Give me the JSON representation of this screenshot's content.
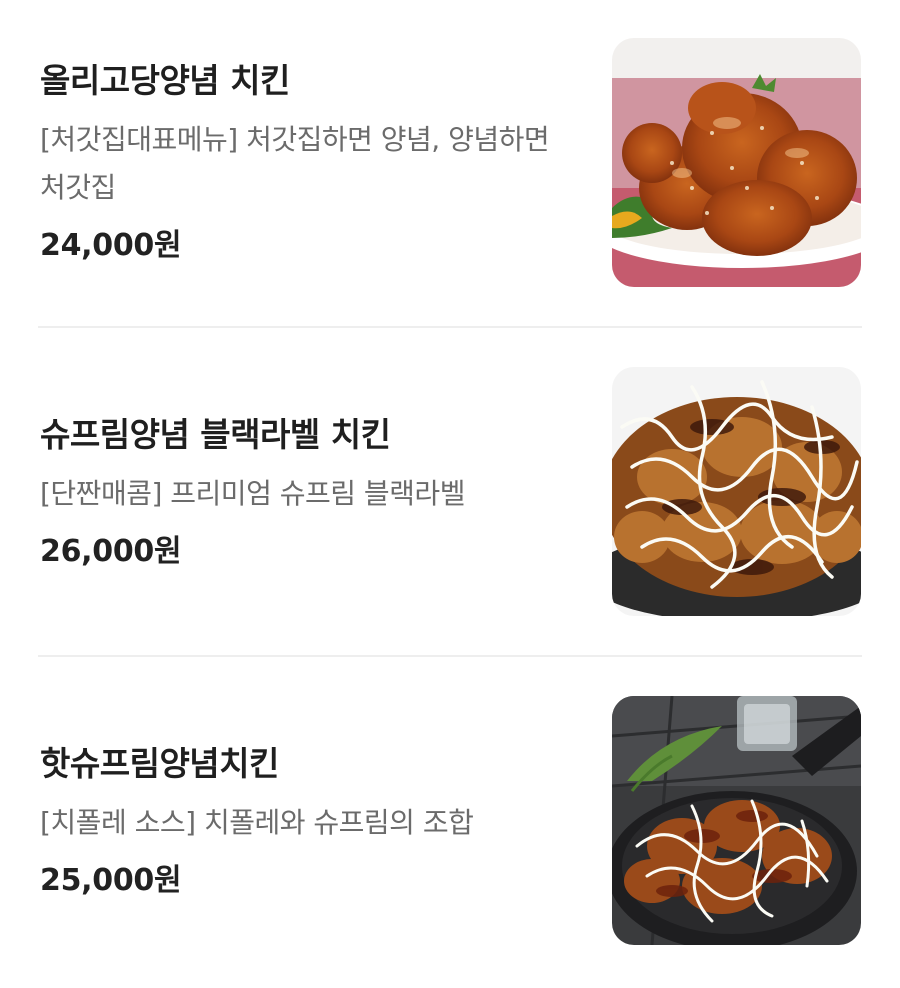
{
  "menu": {
    "items": [
      {
        "name": "올리고당양념 치킨",
        "description": "[처갓집대표메뉴] 처갓집하면 양념, 양념하면 처갓집",
        "price": "24,000원",
        "image": "yangnyeom-chicken-plate-photo"
      },
      {
        "name": "슈프림양념 블랙라벨 치킨",
        "description": "[단짠매콤] 프리미엄 슈프림 블랙라벨",
        "price": "26,000원",
        "image": "black-label-chicken-bowl-photo"
      },
      {
        "name": "핫슈프림양념치킨",
        "description": "[치폴레 소스] 치폴레와 슈프림의 조합",
        "price": "25,000원",
        "image": "hot-supreme-chicken-skillet-photo"
      }
    ]
  },
  "colors": {
    "background": "#ffffff",
    "title": "#1f1f1f",
    "description": "#6b6b6b",
    "price": "#222222",
    "divider": "#eeeeee"
  }
}
